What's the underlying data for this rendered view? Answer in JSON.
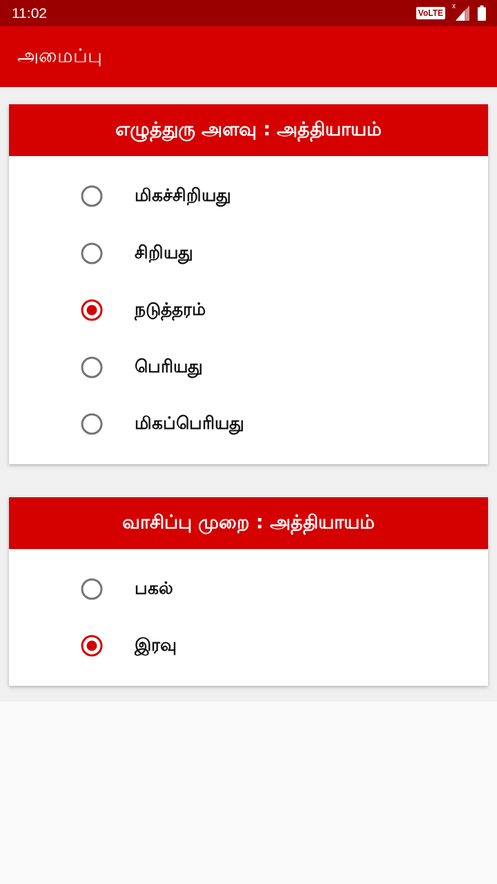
{
  "status_bar": {
    "time": "11:02",
    "network_badge": "VoLTE",
    "signal_mark": "x"
  },
  "app_bar": {
    "title": "அமைப்பு"
  },
  "sections": [
    {
      "title": "எழுத்துரு அளவு : அத்தியாயம்",
      "options": [
        {
          "label": "மிகச்சிறியது",
          "selected": false
        },
        {
          "label": "சிறியது",
          "selected": false
        },
        {
          "label": "நடுத்தரம்",
          "selected": true
        },
        {
          "label": "பெரியது",
          "selected": false
        },
        {
          "label": "மிகப்பெரியது",
          "selected": false
        }
      ]
    },
    {
      "title": "வாசிப்பு முறை : அத்தியாயம்",
      "options": [
        {
          "label": "பகல்",
          "selected": false
        },
        {
          "label": "இரவு",
          "selected": true
        }
      ]
    }
  ]
}
